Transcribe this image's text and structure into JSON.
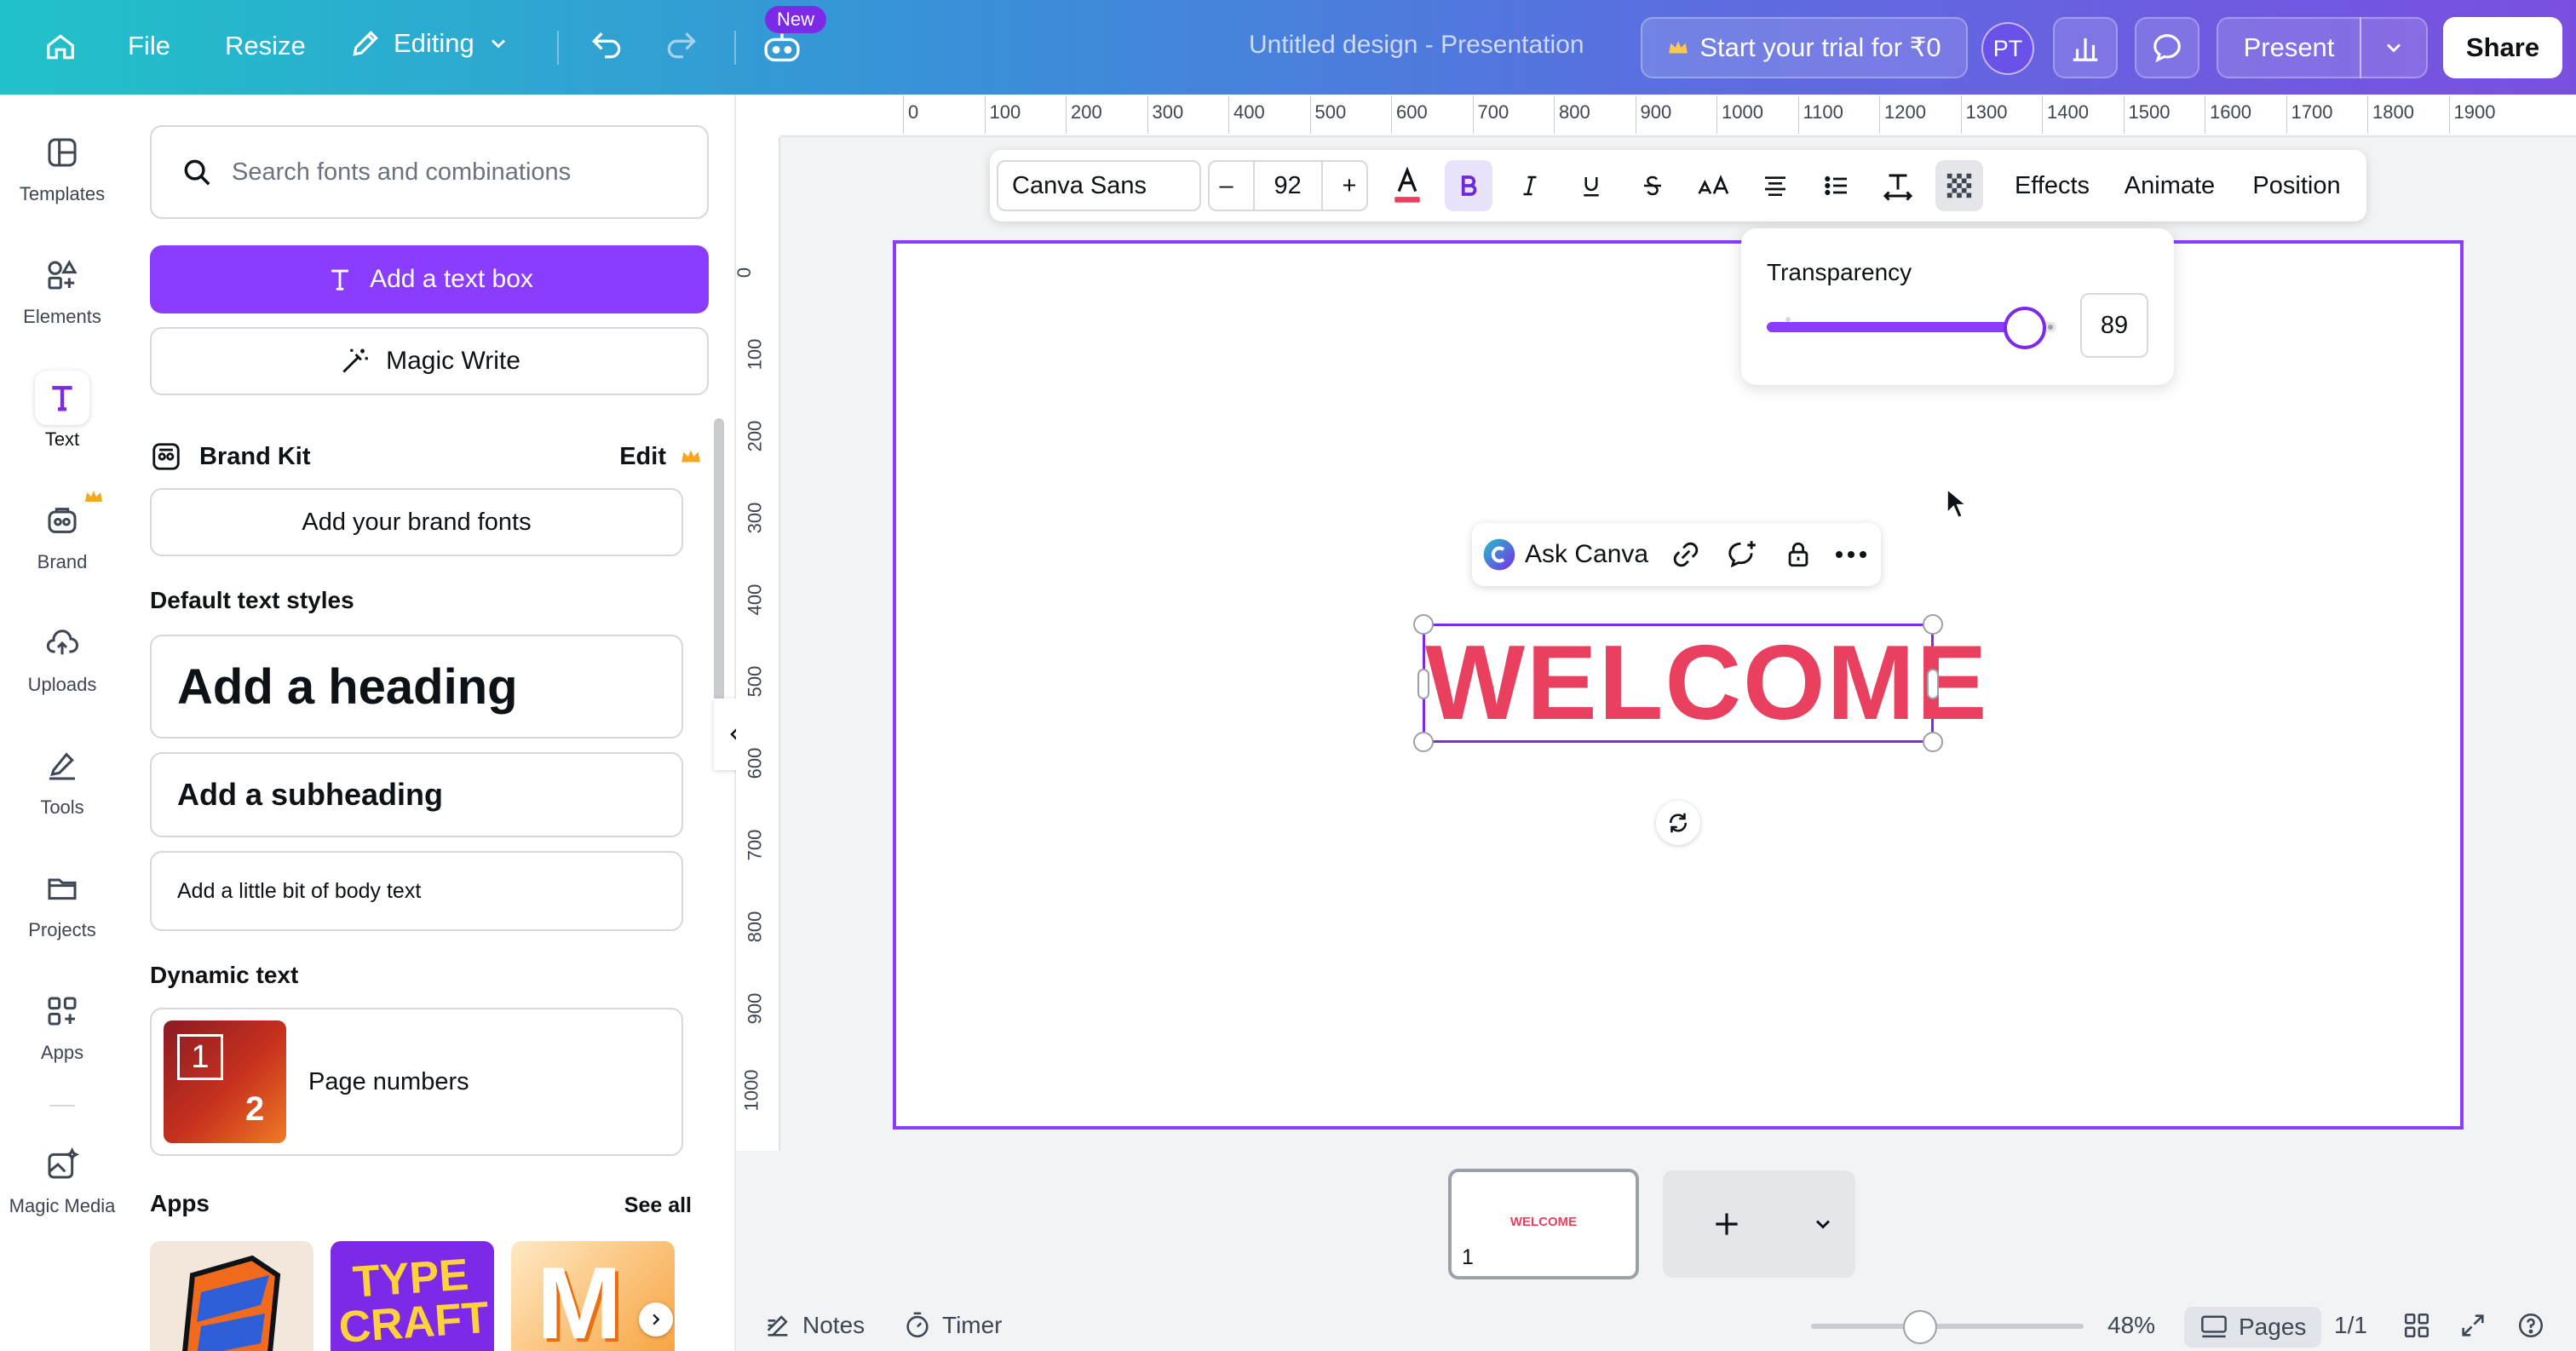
{
  "topbar": {
    "file_label": "File",
    "resize_label": "Resize",
    "editing_label": "Editing",
    "new_badge": "New",
    "document_title": "Untitled design - Presentation",
    "trial_label": "Start your trial for ₹0",
    "avatar_initials": "PT",
    "present_label": "Present",
    "share_label": "Share",
    "gradient_start": "#20c2c9",
    "gradient_end": "#7a4fe0"
  },
  "leftnav": {
    "items": [
      {
        "label": "Templates",
        "icon": "templates-icon"
      },
      {
        "label": "Elements",
        "icon": "elements-icon"
      },
      {
        "label": "Text",
        "icon": "text-icon",
        "active": true
      },
      {
        "label": "Brand",
        "icon": "brand-icon"
      },
      {
        "label": "Uploads",
        "icon": "cloud-upload-icon"
      },
      {
        "label": "Tools",
        "icon": "pen-tools-icon"
      },
      {
        "label": "Projects",
        "icon": "folder-icon"
      },
      {
        "label": "Apps",
        "icon": "apps-grid-icon"
      },
      {
        "label": "Magic Media",
        "icon": "magic-media-icon"
      }
    ]
  },
  "panel": {
    "search_placeholder": "Search fonts and combinations",
    "add_text_box": "Add a text box",
    "magic_write": "Magic Write",
    "brand_kit_title": "Brand Kit",
    "brand_kit_edit": "Edit",
    "add_brand_fonts": "Add your brand fonts",
    "default_styles_title": "Default text styles",
    "heading": "Add a heading",
    "subheading": "Add a subheading",
    "body_text": "Add a little bit of body text",
    "dynamic_text_title": "Dynamic text",
    "page_numbers": "Page numbers",
    "page_numbers_thumb": [
      "1",
      "2"
    ],
    "apps_title": "Apps",
    "see_all": "See all",
    "app_thumb_text": [
      "TYPE CRAFT",
      "M"
    ],
    "accent": "#8b3dff"
  },
  "rulers": {
    "top": [
      "0",
      "100",
      "200",
      "300",
      "400",
      "500",
      "600",
      "700",
      "800",
      "900",
      "1000",
      "1100",
      "1200",
      "1300",
      "1400",
      "1500",
      "1600",
      "1700",
      "1800",
      "1900"
    ],
    "left": [
      "0",
      "100",
      "200",
      "300",
      "400",
      "500",
      "600",
      "700",
      "800",
      "900",
      "1000"
    ]
  },
  "format_toolbar": {
    "font": "Canva Sans",
    "size": "92",
    "minus": "–",
    "plus": "+",
    "effects": "Effects",
    "animate": "Animate",
    "position": "Position",
    "text_color": "#e8405e"
  },
  "transparency": {
    "title": "Transparency",
    "value": "89",
    "fraction": 0.89
  },
  "context_menu": {
    "ask_canva": "Ask Canva"
  },
  "canvas": {
    "text": "WELCOME",
    "text_color": "#e8405e",
    "selection_color": "#7d2ae8"
  },
  "pages": {
    "thumb_text": "WELCOME",
    "thumb_number": "1"
  },
  "bottombar": {
    "notes": "Notes",
    "timer": "Timer",
    "zoom": "48%",
    "pages": "Pages",
    "page_count": "1/1"
  }
}
